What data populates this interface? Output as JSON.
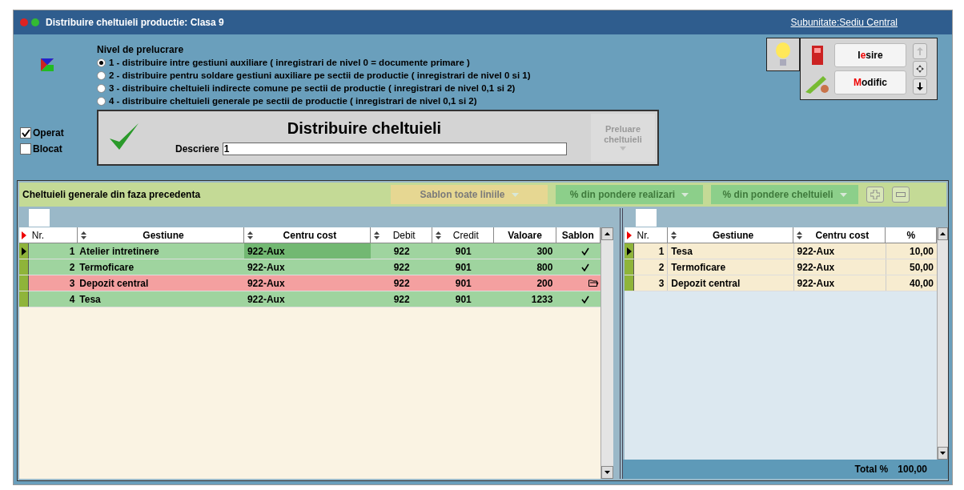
{
  "window": {
    "title": "Distribuire cheltuieli productie: Clasa 9",
    "subunit": "Subunitate:Sediu Central"
  },
  "levels": {
    "title": "Nivel de prelucrare",
    "options": [
      {
        "label": "1 - distribuire intre gestiuni auxiliare ( inregistrari de nivel 0 = documente primare )",
        "selected": true
      },
      {
        "label": "2 - distribuire pentru soldare gestiuni auxiliare pe sectii de productie  ( inregistrari de nivel 0 si 1)",
        "selected": false
      },
      {
        "label": "3 - distribuire cheltuieli indirecte comune pe sectii de productie ( inregistrari de nivel 0,1 si 2)",
        "selected": false
      },
      {
        "label": "4 - distribuire cheltuieli generale pe sectii de productie ( inregistrari de nivel 0,1 si 2)",
        "selected": false
      }
    ]
  },
  "flags": [
    {
      "label": "Operat",
      "checked": true
    },
    {
      "label": "Blocat",
      "checked": false
    }
  ],
  "form": {
    "title": "Distribuire cheltuieli",
    "description_label": "Descriere",
    "description_value": "1",
    "fetch_button": {
      "label": "Preluare cheltuieli",
      "disabled": true
    }
  },
  "actions": [
    {
      "kind": "exit",
      "before": "I",
      "key": "e",
      "after": "sire"
    },
    {
      "kind": "edit",
      "key": "M",
      "after": "odific"
    }
  ],
  "left": {
    "title": "Cheltuieli generale din faza precedenta",
    "dropdowns": [
      {
        "label": "Sablon toate liniile",
        "kind": "yellow"
      },
      {
        "label": "% din pondere realizari",
        "kind": "green"
      },
      {
        "label": "% din pondere cheltuieli",
        "kind": "green"
      }
    ],
    "columns": [
      "Nr.",
      "Gestiune",
      "Centru cost",
      "Debit",
      "Credit",
      "Valoare",
      "Sablon"
    ],
    "rows": [
      {
        "nr": "1",
        "gestiune": "Atelier intretinere",
        "centru": "922-Aux",
        "debit": "922",
        "credit": "901",
        "valoare": "300",
        "kind": "check",
        "color": "#9fd49f",
        "selected": true
      },
      {
        "nr": "2",
        "gestiune": "Termoficare",
        "centru": "922-Aux",
        "debit": "922",
        "credit": "901",
        "valoare": "800",
        "kind": "check",
        "color": "#9fd49f",
        "selected": false
      },
      {
        "nr": "3",
        "gestiune": "Depozit central",
        "centru": "922-Aux",
        "debit": "922",
        "credit": "901",
        "valoare": "200",
        "kind": "folder",
        "color": "#f4a0a0",
        "selected": false
      },
      {
        "nr": "4",
        "gestiune": "Tesa",
        "centru": "922-Aux",
        "debit": "922",
        "credit": "901",
        "valoare": "1233",
        "kind": "check",
        "color": "#9fd49f",
        "selected": false
      }
    ]
  },
  "right": {
    "columns": [
      "Nr.",
      "Gestiune",
      "Centru cost",
      "%"
    ],
    "rows": [
      {
        "nr": "1",
        "gestiune": "Tesa",
        "centru": "922-Aux",
        "pct": "10,00",
        "selected": true
      },
      {
        "nr": "2",
        "gestiune": "Termoficare",
        "centru": "922-Aux",
        "pct": "50,00",
        "selected": false
      },
      {
        "nr": "3",
        "gestiune": "Depozit central",
        "centru": "922-Aux",
        "pct": "40,00",
        "selected": false
      }
    ],
    "total_label": "Total %",
    "total_value": "100,00"
  }
}
